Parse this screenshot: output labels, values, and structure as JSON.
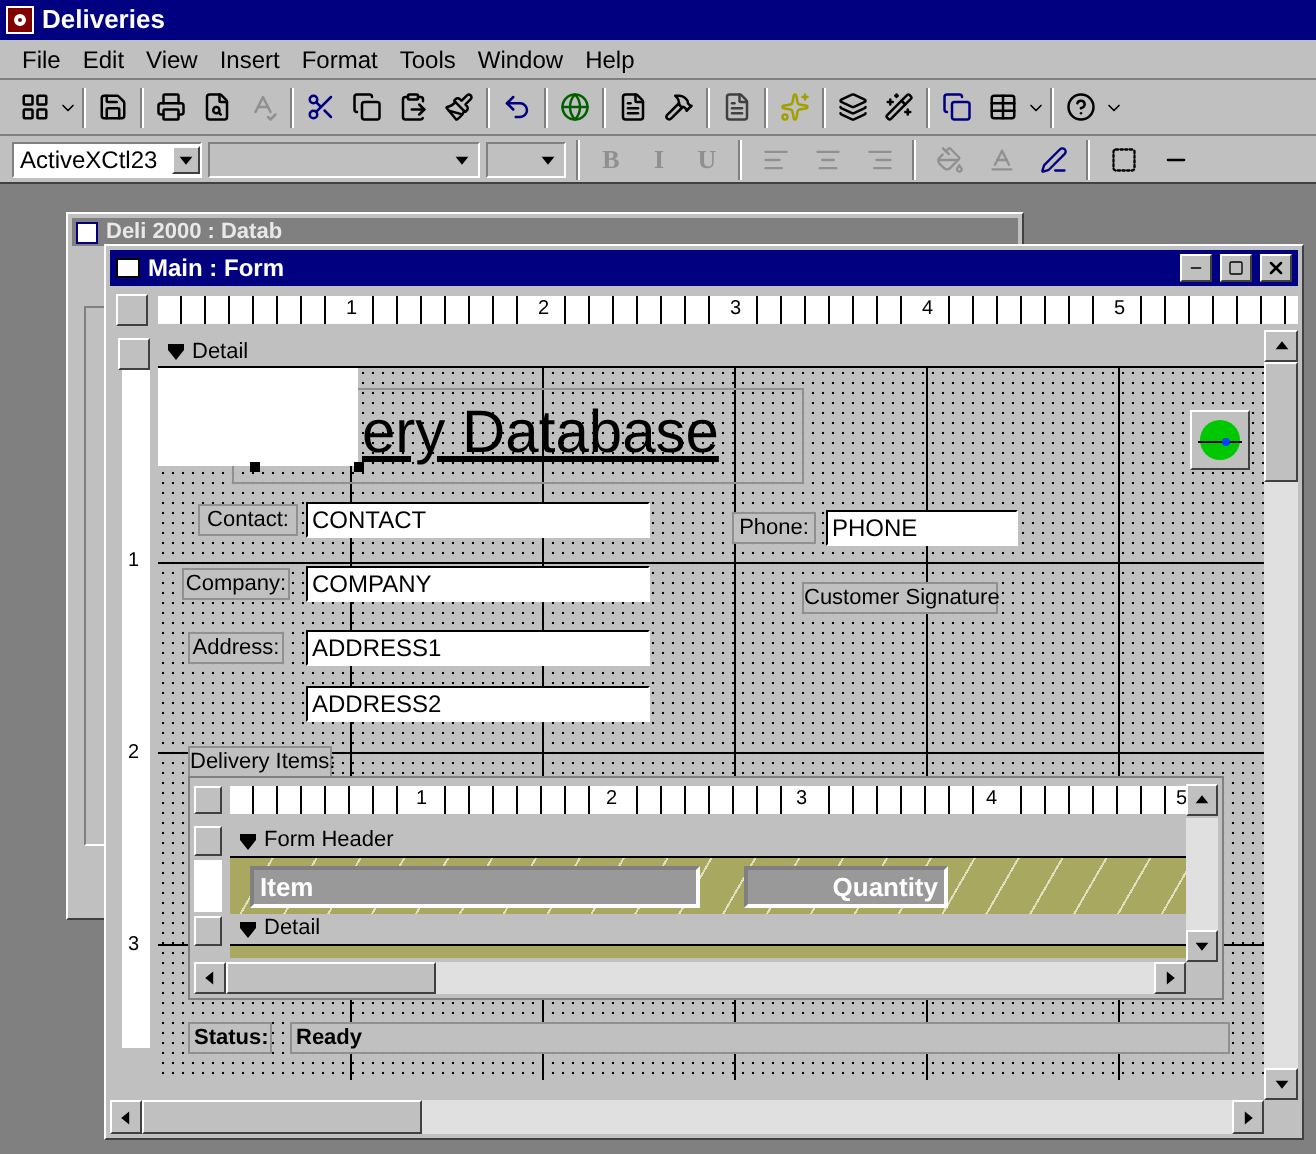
{
  "app_title": "Deliveries",
  "menu": [
    "File",
    "Edit",
    "View",
    "Insert",
    "Format",
    "Tools",
    "Window",
    "Help"
  ],
  "formatting": {
    "object_box": "ActiveXCtl23",
    "style_buttons": [
      {
        "label": "B",
        "disabled": true
      },
      {
        "label": "I",
        "disabled": true
      },
      {
        "label": "U",
        "disabled": true
      }
    ]
  },
  "background_window": {
    "title": "Deli 2000 : Datab"
  },
  "form_window": {
    "title": "Main : Form",
    "ruler_labels": [
      "1",
      "2",
      "3",
      "4",
      "5"
    ],
    "vertical_ruler_labels": [
      "1",
      "2",
      "3"
    ],
    "section": "Detail",
    "title_label": "ery Database",
    "controls": [
      {
        "kind": "label",
        "text": "Contact:"
      },
      {
        "kind": "textbox",
        "text": "CONTACT"
      },
      {
        "kind": "label",
        "text": "Phone:"
      },
      {
        "kind": "textbox",
        "text": "PHONE"
      },
      {
        "kind": "label",
        "text": "Company:"
      },
      {
        "kind": "textbox",
        "text": "COMPANY"
      },
      {
        "kind": "label",
        "text": "Customer Signature"
      },
      {
        "kind": "label",
        "text": "Address:"
      },
      {
        "kind": "textbox",
        "text": "ADDRESS1"
      },
      {
        "kind": "textbox",
        "text": "ADDRESS2"
      },
      {
        "kind": "label",
        "text": "Delivery Items:"
      },
      {
        "kind": "bold_label",
        "text": "Status:"
      },
      {
        "kind": "bold_label",
        "text": "Ready"
      }
    ],
    "subform": {
      "ruler_labels": [
        "1",
        "2",
        "3",
        "4",
        "5"
      ],
      "header_section": "Form Header",
      "columns": [
        "Item",
        "Quantity"
      ],
      "detail_section": "Detail"
    }
  }
}
